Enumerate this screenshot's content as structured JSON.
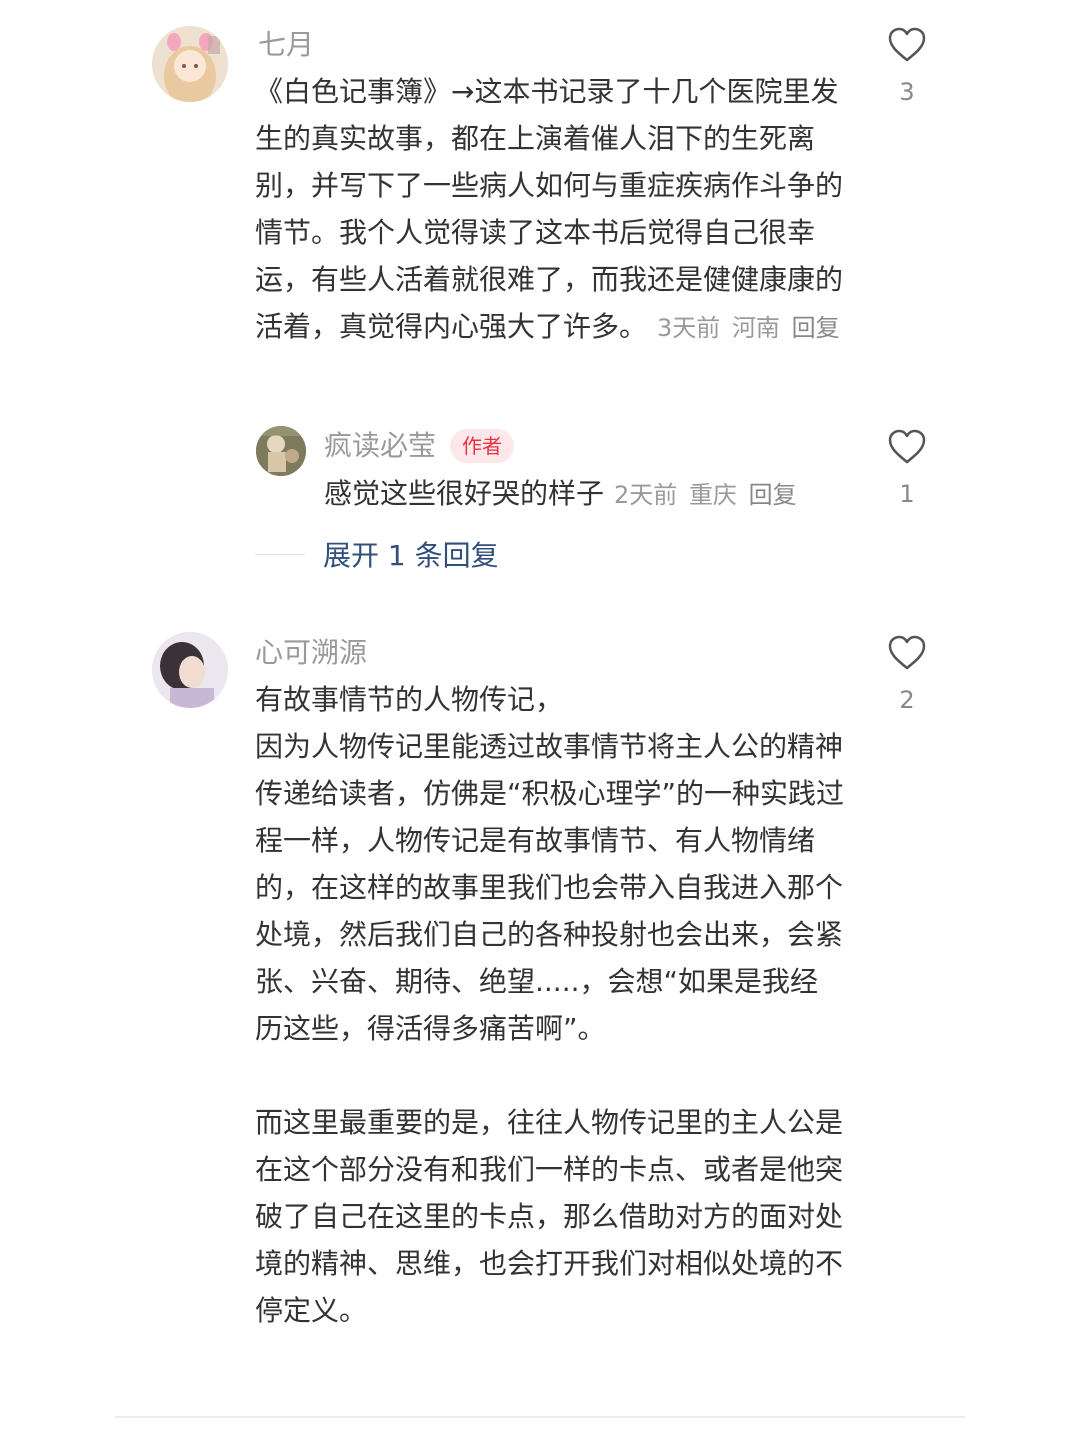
{
  "comments": [
    {
      "username": "七月",
      "text": "《白色记事簿》→这本书记录了十几个医院里发生的真实故事，都在上演着催人泪下的生死离别，并写下了一些病人如何与重症疾病作斗争的情节。我个人觉得读了这本书后觉得自己很幸运，有些人活着就很难了，而我还是健健康康的活着，真觉得内心强大了许多。",
      "time": "3天前",
      "location": "河南",
      "reply_label": "回复",
      "likes": "3",
      "replies": [
        {
          "username": "疯读必莹",
          "badge": "作者",
          "text": "感觉这些很好哭的样子",
          "time": "2天前",
          "location": "重庆",
          "reply_label": "回复",
          "likes": "1"
        }
      ],
      "expand_label": "展开 1 条回复"
    },
    {
      "username": "心可溯源",
      "text": "有故事情节的人物传记，\n因为人物传记里能透过故事情节将主人公的精神传递给读者，仿佛是“积极心理学”的一种实践过程一样，人物传记是有故事情节、有人物情绪的，在这样的故事里我们也会带入自我进入那个处境，然后我们自己的各种投射也会出来，会紧张、兴奋、期待、绝望.....，会想“如果是我经历这些，得活得多痛苦啊”。\n\n而这里最重要的是，往往人物传记里的主人公是在这个部分没有和我们一样的卡点、或者是他突破了自己在这里的卡点，那么借助对方的面对处境的精神、思维，也会打开我们对相似处境的不停定义。",
      "likes": "2"
    }
  ],
  "icons": {
    "like": "heart-outline-icon"
  },
  "colors": {
    "author_badge_bg": "#fde7ea",
    "author_badge_text": "#e8323f",
    "expand_link": "#30507b"
  }
}
